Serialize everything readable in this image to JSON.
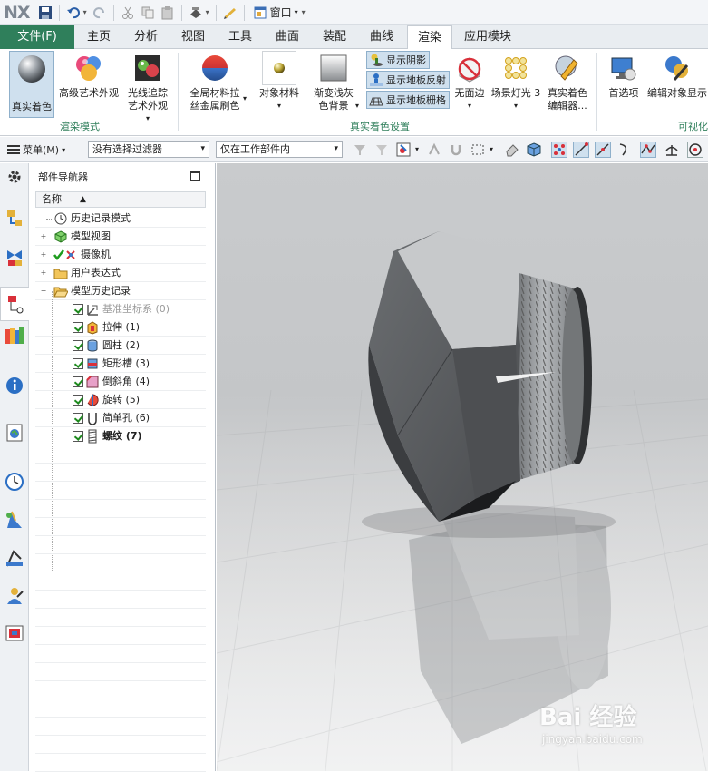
{
  "app": {
    "logo": "NX"
  },
  "quick_access": {
    "window_menu": "窗口"
  },
  "tabs": [
    "文件(F)",
    "主页",
    "分析",
    "视图",
    "工具",
    "曲面",
    "装配",
    "曲线",
    "渲染",
    "应用模块"
  ],
  "active_tab": "渲染",
  "ribbon": {
    "group_render_mode": {
      "label": "渲染模式",
      "buttons": [
        "真实着色",
        "高级艺术外观",
        "光线追踪",
        "艺术外观"
      ]
    },
    "group_true_shading": {
      "label": "真实着色设置",
      "buttons": {
        "global_material_1": "全局材料拉",
        "global_material_2": "丝金属刷色",
        "object_material": "对象材料",
        "gradient_bg_1": "渐变浅灰",
        "gradient_bg_2": "色背景",
        "show_shadow": "显示阴影",
        "show_floor_reflection": "显示地板反射",
        "show_floor_grid": "显示地板栅格",
        "no_face_edge": "无面边",
        "scene_light": "场景灯光 3",
        "true_shading_editor_1": "真实着色",
        "true_shading_editor_2": "编辑器..."
      }
    },
    "group_visual": {
      "label": "可视化",
      "buttons": {
        "preferences": "首选项",
        "edit_object_display": "编辑对象显示"
      }
    }
  },
  "selection_bar": {
    "menu": "菜单(M)",
    "filter": "没有选择过滤器",
    "scope": "仅在工作部件内"
  },
  "navigator": {
    "title": "部件导航器",
    "column_name": "名称",
    "rows": [
      {
        "label": "历史记录模式"
      },
      {
        "label": "模型视图"
      },
      {
        "label": "摄像机"
      },
      {
        "label": "用户表达式"
      },
      {
        "label": "模型历史记录"
      },
      {
        "label": "基准坐标系 (0)"
      },
      {
        "label": "拉伸 (1)"
      },
      {
        "label": "圆柱 (2)"
      },
      {
        "label": "矩形槽 (3)"
      },
      {
        "label": "倒斜角 (4)"
      },
      {
        "label": "旋转 (5)"
      },
      {
        "label": "简单孔 (6)"
      },
      {
        "label": "螺纹 (7)"
      }
    ]
  },
  "viewport": {
    "watermark": "Bai 经验",
    "watermark_url": "jingyan.baidu.com"
  },
  "colors": {
    "file_tab": "#2f7f5b",
    "group_label": "#2f7f5b",
    "accent": "#cfe0ee"
  }
}
